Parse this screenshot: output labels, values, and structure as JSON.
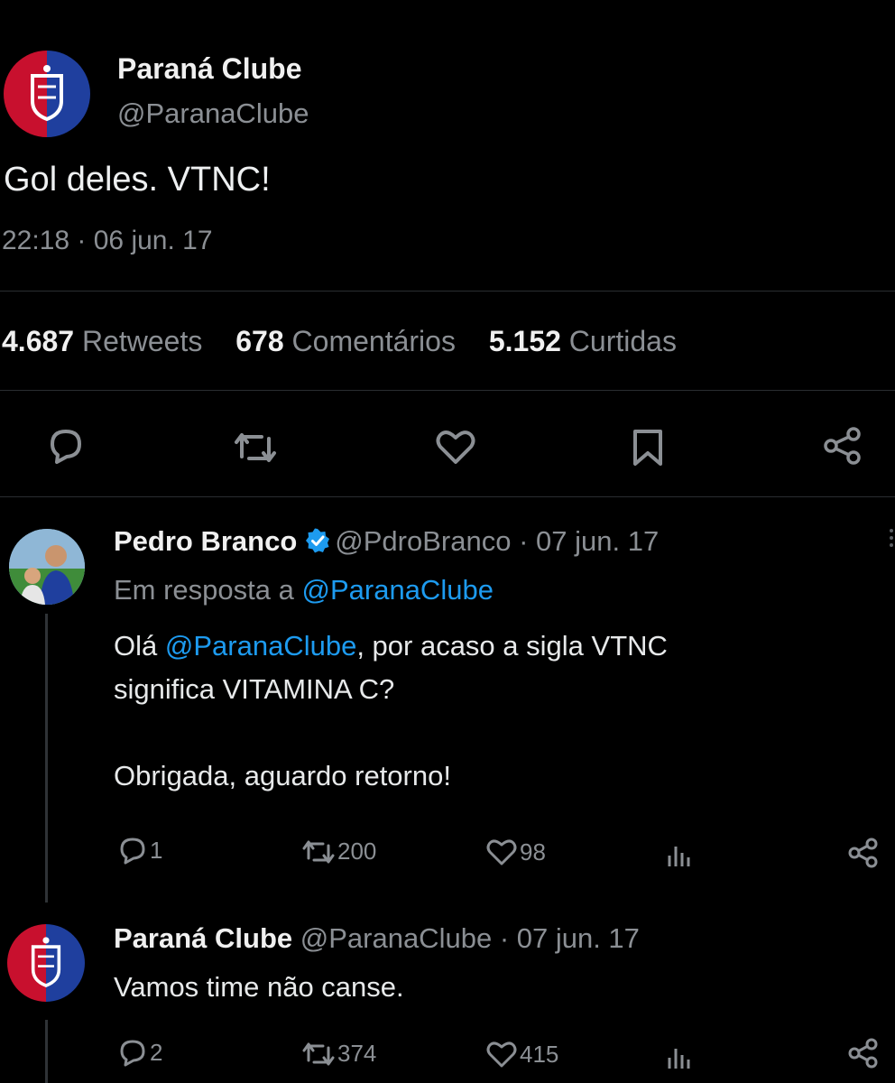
{
  "main_tweet": {
    "display_name": "Paraná Clube",
    "handle": "@ParanaClube",
    "text": "Gol deles. VTNC!",
    "timestamp": "22:18 · 06 jun. 17",
    "stats": {
      "retweets_count": "4.687",
      "retweets_label": "Retweets",
      "comments_count": "678",
      "comments_label": "Comentários",
      "likes_count": "5.152",
      "likes_label": "Curtidas"
    },
    "actions": [
      "reply-icon",
      "retweet-icon",
      "like-icon",
      "bookmark-icon",
      "share-icon"
    ]
  },
  "replies": [
    {
      "display_name": "Pedro Branco",
      "handle": "@PdroBranco",
      "date": "· 07 jun. 17",
      "verified": true,
      "reply_to_prefix": "Em resposta a",
      "reply_to_handle": "@ParanaClube",
      "body_prefix": "Olá",
      "body_mention": "@ParanaClube",
      "body_line1_rest": ", por acaso a sigla VTNC",
      "body_line2": "significa VITAMINA C?",
      "body_line3": "Obrigada, aguardo retorno!",
      "replies_count": "1",
      "retweets_count": "200",
      "likes_count": "98"
    },
    {
      "display_name": "Paraná Clube",
      "handle": "@ParanaClube",
      "date": "· 07 jun. 17",
      "body": "Vamos time não canse.",
      "replies_count": "2",
      "retweets_count": "374",
      "likes_count": "415"
    }
  ],
  "colors": {
    "background": "#000000",
    "text": "#e7e9ea",
    "muted": "#8b8f94",
    "mention": "#1d9bf0",
    "club_red": "#c8102e",
    "club_blue": "#1f3f9e"
  }
}
